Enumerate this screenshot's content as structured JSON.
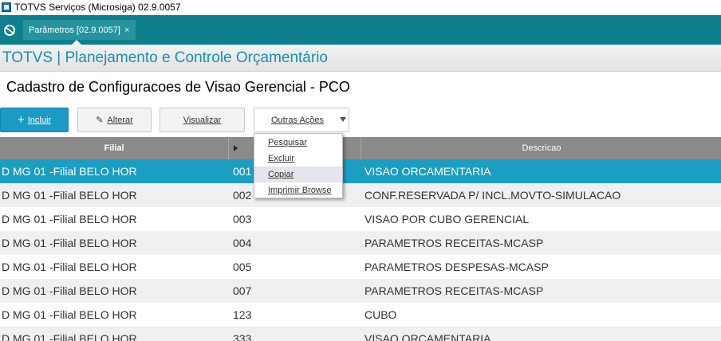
{
  "window": {
    "title": "TOTVS Serviços (Microsiga) 02.9.0057"
  },
  "tabs": [
    {
      "label": "Parâmetros [02.9.0057]",
      "close": "×"
    }
  ],
  "app": {
    "title": "TOTVS | Planejamento e Controle Orçamentário"
  },
  "page": {
    "title": "Cadastro de Configuracoes de Visao Gerencial - PCO"
  },
  "toolbar": {
    "incluir": {
      "icon": "+",
      "label": "Incluir"
    },
    "alterar": {
      "icon": "✎",
      "label": "Alterar"
    },
    "visualizar": {
      "label": "Visualizar"
    },
    "outras": {
      "label": "Outras Ações"
    }
  },
  "menu": {
    "items": [
      {
        "label": "Pesquisar"
      },
      {
        "label": "Excluir"
      },
      {
        "label": "Copiar"
      },
      {
        "label": "Imprimir Browse"
      }
    ]
  },
  "grid": {
    "columns": {
      "filial": "Filial",
      "descricao": "Descricao"
    },
    "rows": [
      {
        "filial": "D MG 01 -Filial BELO HOR",
        "codigo": "001",
        "descricao": "VISAO ORCAMENTARIA"
      },
      {
        "filial": "D MG 01 -Filial BELO HOR",
        "codigo": "002",
        "descricao": "CONF.RESERVADA P/ INCL.MOVTO-SIMULACAO"
      },
      {
        "filial": "D MG 01 -Filial BELO HOR",
        "codigo": "003",
        "descricao": "VISAO POR CUBO GERENCIAL"
      },
      {
        "filial": "D MG 01 -Filial BELO HOR",
        "codigo": "004",
        "descricao": "PARAMETROS RECEITAS-MCASP"
      },
      {
        "filial": "D MG 01 -Filial BELO HOR",
        "codigo": "005",
        "descricao": "PARAMETROS DESPESAS-MCASP"
      },
      {
        "filial": "D MG 01 -Filial BELO HOR",
        "codigo": "007",
        "descricao": "PARAMETROS RECEITAS-MCASP"
      },
      {
        "filial": "D MG 01 -Filial BELO HOR",
        "codigo": "123",
        "descricao": "CUBO"
      },
      {
        "filial": "D MG 01 -Filial BELO HOR",
        "codigo": "333",
        "descricao": "VISAO ORCAMENTARIA"
      }
    ]
  },
  "colors": {
    "tabbar": "#0d7f8d",
    "accent": "#1a8fb0",
    "selected_row": "#1a9fc3",
    "primary_button": "#1b9ac2",
    "grid_header": "#8a8a8a"
  }
}
